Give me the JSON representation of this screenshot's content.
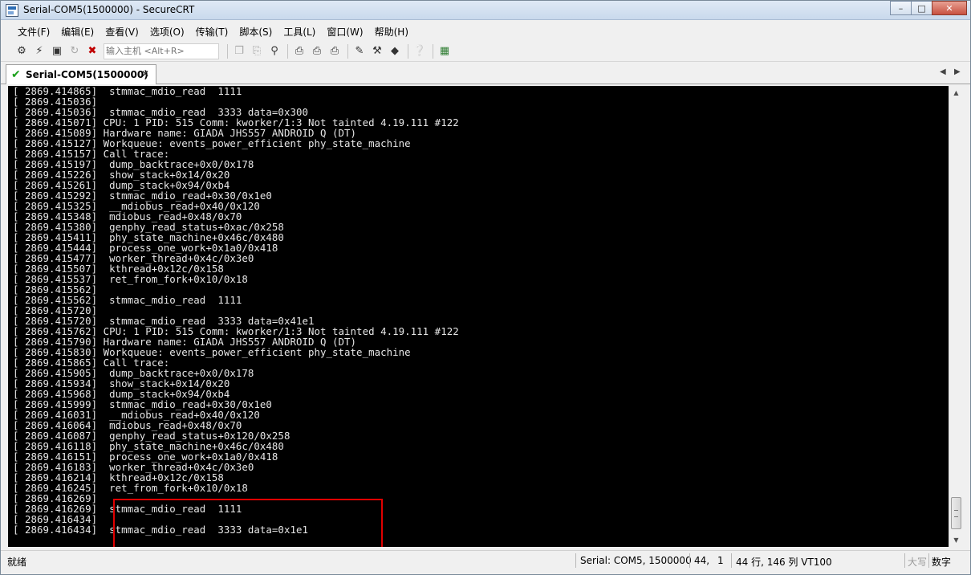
{
  "window": {
    "title": "Serial-COM5(1500000) - SecureCRT",
    "minimize_glyph": "–",
    "maximize_glyph": "□",
    "close_glyph": "✕"
  },
  "menu": [
    {
      "label": "文件(F)"
    },
    {
      "label": "编辑(E)"
    },
    {
      "label": "查看(V)"
    },
    {
      "label": "选项(O)"
    },
    {
      "label": "传输(T)"
    },
    {
      "label": "脚本(S)"
    },
    {
      "label": "工具(L)"
    },
    {
      "label": "窗口(W)"
    },
    {
      "label": "帮助(H)"
    }
  ],
  "toolbar": {
    "connect_icon": "connect-icon",
    "quick_connect_icon": "quick-connect-icon",
    "connect_tab_icon": "connect-in-tab-icon",
    "reconnect_icon": "reconnect-icon",
    "disconnect_icon": "disconnect-icon",
    "host_input_placeholder": "输入主机 <Alt+R>",
    "copy_icon": "copy-icon",
    "paste_icon": "paste-icon",
    "find_icon": "find-icon",
    "print_icon": "print-icon",
    "print_selection_icon": "print-selection-icon",
    "print_setup_icon": "print-setup-icon",
    "session_options_icon": "session-options-icon",
    "global_options_icon": "global-options-icon",
    "keymap_icon": "keymap-icon",
    "help_icon": "help-icon",
    "sftp_icon": "sftp-icon"
  },
  "tab": {
    "label": "Serial-COM5(1500000)",
    "status_icon": "check-icon",
    "close_glyph": "✕",
    "scroll_left_glyph": "◀",
    "scroll_right_glyph": "▶"
  },
  "terminal": {
    "lines": [
      "[ 2869.414865]  stmmac_mdio_read  1111",
      "[ 2869.415036]",
      "[ 2869.415036]  stmmac_mdio_read  3333 data=0x300",
      "[ 2869.415071] CPU: 1 PID: 515 Comm: kworker/1:3 Not tainted 4.19.111 #122",
      "[ 2869.415089] Hardware name: GIADA JHS557 ANDROID Q (DT)",
      "[ 2869.415127] Workqueue: events_power_efficient phy_state_machine",
      "[ 2869.415157] Call trace:",
      "[ 2869.415197]  dump_backtrace+0x0/0x178",
      "[ 2869.415226]  show_stack+0x14/0x20",
      "[ 2869.415261]  dump_stack+0x94/0xb4",
      "[ 2869.415292]  stmmac_mdio_read+0x30/0x1e0",
      "[ 2869.415325]  __mdiobus_read+0x40/0x120",
      "[ 2869.415348]  mdiobus_read+0x48/0x70",
      "[ 2869.415380]  genphy_read_status+0xac/0x258",
      "[ 2869.415411]  phy_state_machine+0x46c/0x480",
      "[ 2869.415444]  process_one_work+0x1a0/0x418",
      "[ 2869.415477]  worker_thread+0x4c/0x3e0",
      "[ 2869.415507]  kthread+0x12c/0x158",
      "[ 2869.415537]  ret_from_fork+0x10/0x18",
      "[ 2869.415562]",
      "[ 2869.415562]  stmmac_mdio_read  1111",
      "[ 2869.415720]",
      "[ 2869.415720]  stmmac_mdio_read  3333 data=0x41e1",
      "[ 2869.415762] CPU: 1 PID: 515 Comm: kworker/1:3 Not tainted 4.19.111 #122",
      "[ 2869.415790] Hardware name: GIADA JHS557 ANDROID Q (DT)",
      "[ 2869.415830] Workqueue: events_power_efficient phy_state_machine",
      "[ 2869.415865] Call trace:",
      "[ 2869.415905]  dump_backtrace+0x0/0x178",
      "[ 2869.415934]  show_stack+0x14/0x20",
      "[ 2869.415968]  dump_stack+0x94/0xb4",
      "[ 2869.415999]  stmmac_mdio_read+0x30/0x1e0",
      "[ 2869.416031]  __mdiobus_read+0x40/0x120",
      "[ 2869.416064]  mdiobus_read+0x48/0x70",
      "[ 2869.416087]  genphy_read_status+0x120/0x258",
      "[ 2869.416118]  phy_state_machine+0x46c/0x480",
      "[ 2869.416151]  process_one_work+0x1a0/0x418",
      "[ 2869.416183]  worker_thread+0x4c/0x3e0",
      "[ 2869.416214]  kthread+0x12c/0x158",
      "[ 2869.416245]  ret_from_fork+0x10/0x18",
      "[ 2869.416269]",
      "[ 2869.416269]  stmmac_mdio_read  1111",
      "[ 2869.416434]",
      "[ 2869.416434]  stmmac_mdio_read  3333 data=0x1e1"
    ],
    "highlight_color": "#e00000",
    "background": "#000000",
    "foreground": "#e6e6e6"
  },
  "scrollbar": {
    "up_glyph": "▲",
    "down_glyph": "▼"
  },
  "statusbar": {
    "ready": "就绪",
    "connection": "Serial: COM5, 1500000",
    "row": "44,",
    "col": "1",
    "size": "44 行, 146 列 VT100",
    "caps": "大写",
    "num": "数字"
  }
}
